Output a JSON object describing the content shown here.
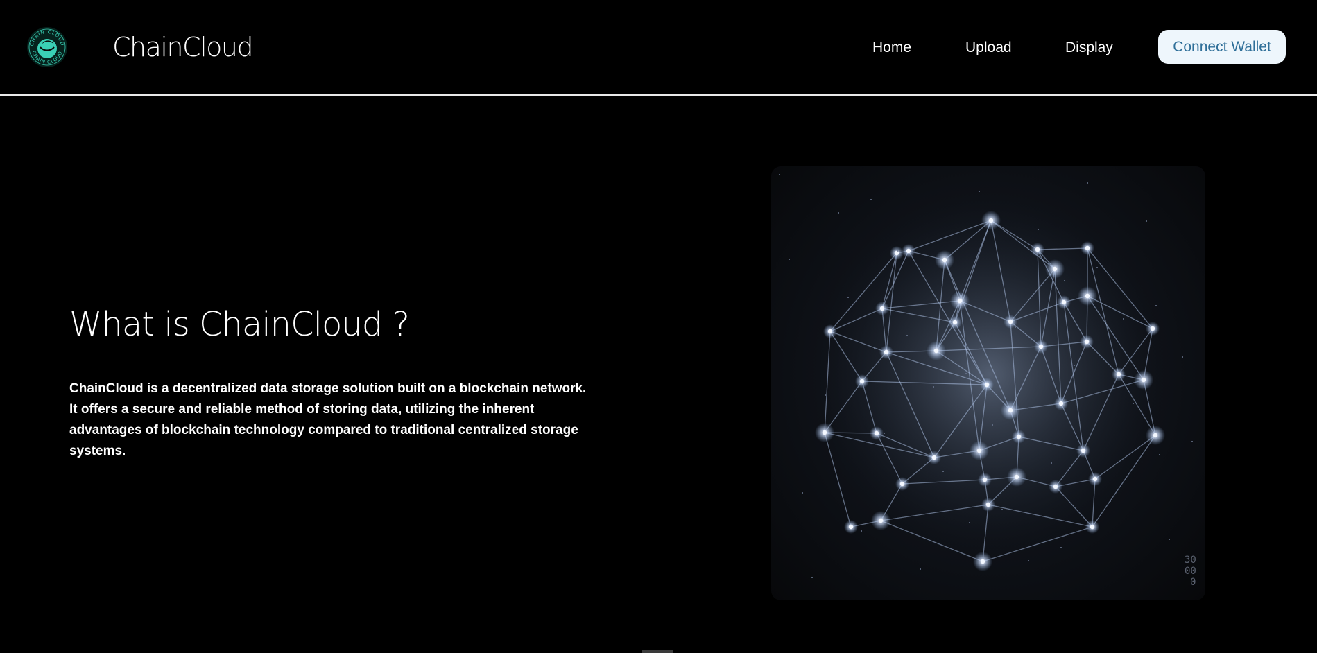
{
  "brand": {
    "name": "ChainCloud",
    "logo_ring_text": "CHAIN CLOUD",
    "logo_color": "#3ad0b5"
  },
  "nav": {
    "items": [
      {
        "label": "Home"
      },
      {
        "label": "Upload"
      },
      {
        "label": "Display"
      }
    ],
    "connect_label": "Connect Wallet"
  },
  "hero": {
    "title": "What is ChainCloud ?",
    "description": "ChainCloud is a decentralized data storage solution built on a blockchain network. It offers a secure and reliable method of storing data, utilizing the inherent advantages of blockchain technology compared to traditional centralized storage systems.",
    "image": {
      "subject": "glowing network of connected nodes",
      "corner_mark": [
        "30",
        "00",
        "0"
      ]
    }
  },
  "colors": {
    "background": "#000000",
    "text": "#ffffff",
    "button_bg": "#eef6fc",
    "button_text": "#2f6f99",
    "divider": "#e9e9e9"
  }
}
